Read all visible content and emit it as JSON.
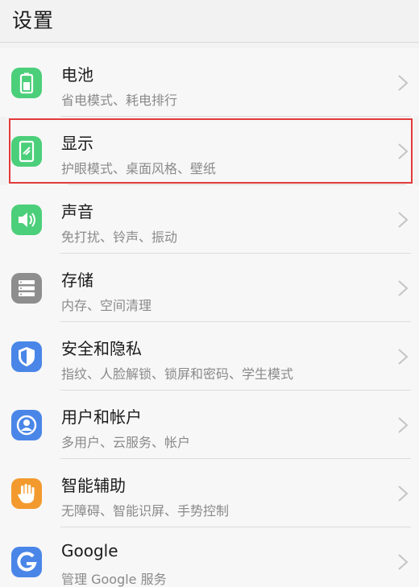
{
  "header": {
    "title": "设置"
  },
  "colors": {
    "green": "#4ccf7a",
    "grey": "#8e8e8e",
    "blue": "#4a86e8",
    "orange": "#f39a2f",
    "highlight": "#e23a3a"
  },
  "items": [
    {
      "title": "电池",
      "subtitle": "省电模式、耗电排行",
      "icon": "battery-icon"
    },
    {
      "title": "显示",
      "subtitle": "护眼模式、桌面风格、壁纸",
      "icon": "display-icon"
    },
    {
      "title": "声音",
      "subtitle": "免打扰、铃声、振动",
      "icon": "sound-icon"
    },
    {
      "title": "存储",
      "subtitle": "内存、空间清理",
      "icon": "storage-icon"
    },
    {
      "title": "安全和隐私",
      "subtitle": "指纹、人脸解锁、锁屏和密码、学生模式",
      "icon": "shield-icon"
    },
    {
      "title": "用户和帐户",
      "subtitle": "多用户、云服务、帐户",
      "icon": "user-icon"
    },
    {
      "title": "智能辅助",
      "subtitle": "无障碍、智能识屏、手势控制",
      "icon": "hand-icon"
    },
    {
      "title": "Google",
      "subtitle": "管理 Google 服务",
      "icon": "google-icon"
    }
  ]
}
